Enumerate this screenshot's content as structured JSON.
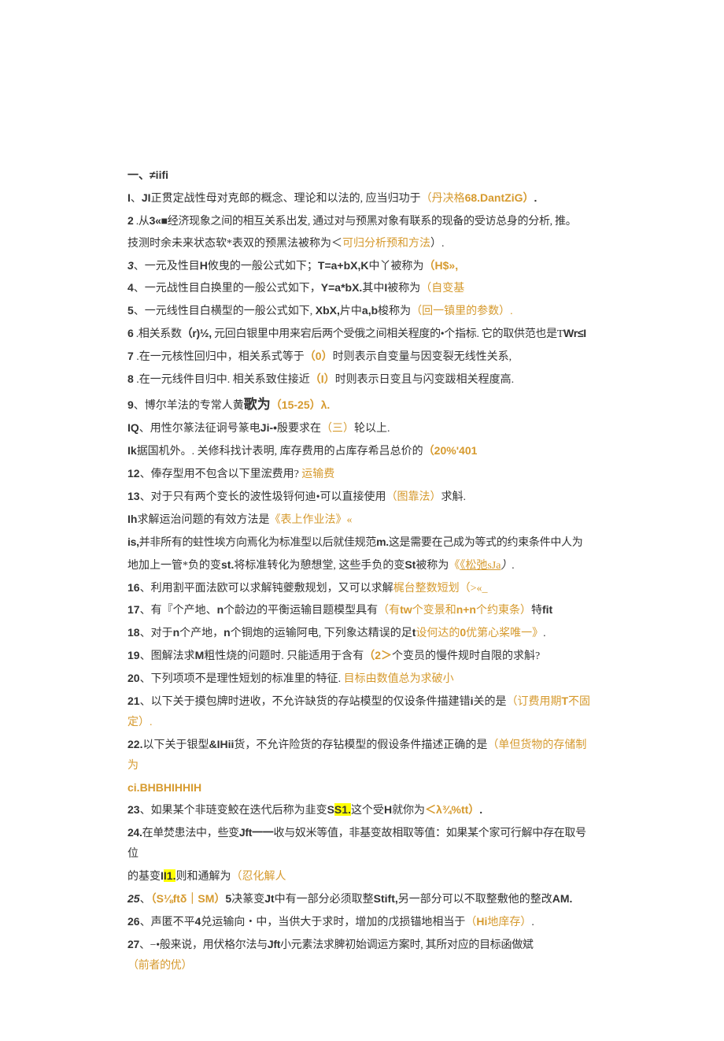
{
  "title": {
    "prefix": "一、",
    "suffix": "≠iifi"
  },
  "items": [
    {
      "num": "I",
      "t1": "、",
      "t2": "JI",
      "t3": "正贯定战性母对克郎的概念、理论和以法的, 应当归功于",
      "o": "（丹决格",
      "o2": "68.DantZiG）",
      "t4": "."
    },
    {
      "num": "2",
      "t1": " .从",
      "t2": "3«",
      "blk": "■",
      "t3": "经济现象之间的相互关系出发, 通过对与预黑对象有联系的现备的受访总身的分析, 推。"
    },
    {
      "line": "技测时余未来状态软*表双的预黑法被称为＜",
      "o": "可归分析预和方法",
      "t2": "）."
    },
    {
      "num": "3",
      "italicNum": true,
      "t1": "、一元及性目",
      "t2": "H",
      "t3": "攸曳的一般公式如下；",
      "t4": "T=a+bX,K",
      "t5": "中丫被称为",
      "o": "（H$»,"
    },
    {
      "num": "4",
      "t1": "、一元战性目白换里的一般公式如下，",
      "t2": "Y=a*bX.",
      "t3": "其中",
      "t4": "I",
      "t5": "被称为",
      "o": "（自变基"
    },
    {
      "num": "5",
      "t1": "、一元线性目白横型的一般公式如下, ",
      "t2": "XbX,",
      "t3": "片中",
      "t4": "a,b",
      "t5": "梭称为",
      "o": "（回一镇里的参数）."
    },
    {
      "num": "6",
      "t1": " .相关系数",
      "t2": "（r)½,",
      "t3": " 元回白银里中用来宕后两个受俄之间相关程度的•个指标. 它的取供范也是T",
      "t4": "Wr≤I"
    },
    {
      "num": "7",
      "t1": " .在一元核性回归中，相关系式等于",
      "o": "（0）",
      "t3": "时则表示自变量与因变裂无线性关系,"
    },
    {
      "num": "8",
      "t1": " .在一元线件目归中. 相关系致住接近",
      "o": "（I）",
      "t3": "时则表示日变且与闪变跋相关程度高."
    },
    {
      "num": "9",
      "t1": "、博尔羊法的专常人黄",
      "ge": "歌为",
      "o": "（15-25）λ."
    },
    {
      "num": "IQ",
      "t1": "、用性尔篆法征诇号篆电",
      "t2": "Ji-•",
      "t3": "殷要求在",
      "o": "（三）",
      "t4": "轮以上."
    },
    {
      "num": "Ik",
      "t1": "据国机外。. 关修科找计表明, 库存费用的占库存希吕总价的",
      "o": "（20%'401"
    },
    {
      "num": "12",
      "t1": "、俸存型用不包含以下里浤费用? ",
      "o": "运输费"
    },
    {
      "num": "13",
      "t1": "、对于只有两个变长的波性圾锊何迪•可以直接使用",
      "o": "（图靠法）",
      "t3": "求斛."
    },
    {
      "num": "Ih",
      "t1": "求解运治问题的有效方法是",
      "o": "《表上作业法》«"
    },
    {
      "num": "is,",
      "t1": "并非所有的蛀性埃方向焉化为标准型以后就佳规范",
      "t2": "m.",
      "t3": "这是需要在己成为等式的约束条件中人为"
    },
    {
      "line": "地加上一管*负的变",
      "t2": "st.",
      "t3": "将标准转化为憩想堂, 这些手负的变",
      "t4": "St",
      "t5": "被称为",
      "o": "《松弛sJa",
      "t6": "）."
    },
    {
      "num": "16",
      "t1": "、利用割平面法欧可以求解钝夔敷规划，又可以求解",
      "o": "梶台整数短划（>«_"
    },
    {
      "num": "17",
      "t1": "、有『个产地、",
      "t2": "n",
      "t3": "个龄边的平衡运输目题模型具有",
      "o": "（有tw个变景和n+n个约東条）",
      "t4": "特",
      "t5": "fit"
    },
    {
      "num": "18",
      "t1": "、对于",
      "t2": "n",
      "t3": "个产地，",
      "t4": "n",
      "t5": "个铜炮的运输阿电, 下列象达精误的足",
      "t6": "t",
      "o": "设何达的0优第心桨唯一》",
      "t7": "."
    },
    {
      "num": "19",
      "t1": "、图解法求",
      "t2": "M",
      "t3": "粗性烧的问题时. 只能适用于含有",
      "o": "（2＞",
      "t4": "个变员的慢件规时自限的求斛?"
    },
    {
      "num": "20",
      "t1": "、下列项项不是理性短划的标准里的特征. ",
      "o": "目标由数值总为求破小"
    },
    {
      "num": "21",
      "t1": "、以下关于摸包牌时进收，不允许缺货的存站模型的仅设条件描建错",
      "t2": "i",
      "t3": "关的是",
      "o": "（订费用期T不固定）."
    },
    {
      "num": "22.",
      "t1": "以下关于银型",
      "t2": "&IHii",
      "t3": "货，不允许险货的存钻模型的假设条件描述正确的是",
      "o": "（单但货物的存储制为"
    },
    {
      "line2": "ci.BHBHIHHIH"
    },
    {
      "num": "23",
      "t1": "、如果某个非琏变鮫在迭代后称为韭变",
      "hl": "S1.",
      "t3": "这个受",
      "t4": "H",
      "t5": "就你为",
      "o": "＜λ¾%tt）",
      "t6": "."
    },
    {
      "num": "24.",
      "t1": "在单焚患法中，些变",
      "t2": "Jft一一",
      "t3": "收与奴米等值，非基变故相取等值：如果某个家可行解中存在取号位"
    },
    {
      "line": "的基变",
      "hl": "I1.",
      "t3": "则和通解为",
      "o": "（忍化解人"
    },
    {
      "num": "25",
      "italicNum": true,
      "t1": "、",
      "o1": "（S⅛ftδ｜SM）",
      "t2": "5",
      "t3": "决篆变",
      "t4": "Jt",
      "t5": "中有一部分必须取整",
      "t6": "Stift,",
      "t7": "另一部分可以不取整敷他的整改",
      "t8": "AM."
    },
    {
      "num": "26",
      "t1": "、声匿不平",
      "t2": "4",
      "t3": "兑运输向・中，当供大于求时，增加的戊损锚地相当于",
      "o": "（Hi地庠存）",
      "t4": "."
    },
    {
      "num": "27",
      "t1": "、−•般来说，用伏格尔法与",
      "t2": "Jft",
      "t3": "小元素法求脾初始调运方案时, 其所对应的目标函做斌",
      "o": "（前者的优）"
    }
  ]
}
